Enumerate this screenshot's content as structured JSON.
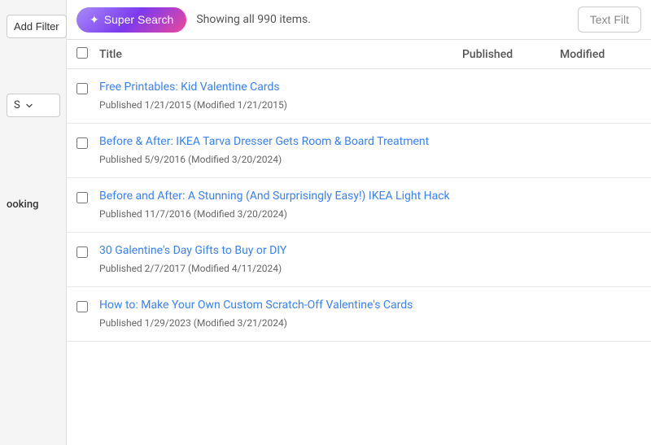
{
  "sidebar": {
    "add_filter_label": "Add Filter",
    "dropdown_label": "S",
    "booking_label": "ooking"
  },
  "toolbar": {
    "super_search_label": "Super Search",
    "super_search_icon": "✦",
    "showing_text": "Showing all 990 items.",
    "text_filter_label": "Text Filt"
  },
  "table": {
    "col_title": "Title",
    "col_published": "Published",
    "col_modified": "Modified"
  },
  "items": [
    {
      "title": "Free Printables: Kid Valentine Cards",
      "meta": "Published 1/21/2015 (Modified 1/21/2015)"
    },
    {
      "title": "Before & After: IKEA Tarva Dresser Gets Room & Board Treatment",
      "meta": "Published 5/9/2016 (Modified 3/20/2024)"
    },
    {
      "title": "Before and After: A Stunning (And Surprisingly Easy!) IKEA Light Hack",
      "meta": "Published 11/7/2016 (Modified 3/20/2024)"
    },
    {
      "title": "30 Galentine's Day Gifts to Buy or DIY",
      "meta": "Published 2/7/2017 (Modified 4/11/2024)"
    },
    {
      "title": "How to: Make Your Own Custom Scratch-Off Valentine's Cards",
      "meta": "Published 1/29/2023 (Modified 3/21/2024)"
    }
  ]
}
